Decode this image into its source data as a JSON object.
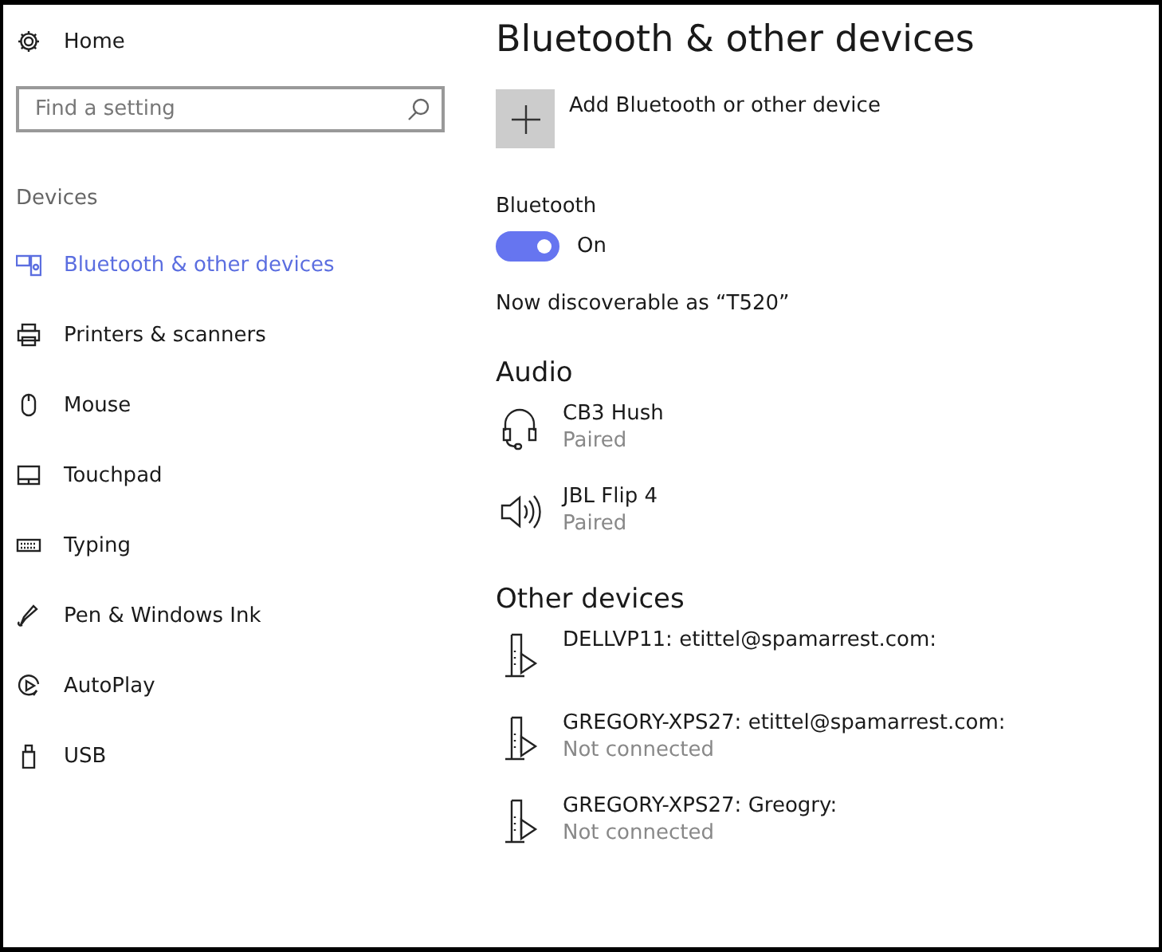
{
  "sidebar": {
    "home": {
      "label": "Home"
    },
    "search": {
      "placeholder": "Find a setting"
    },
    "section": "Devices",
    "items": [
      {
        "label": "Bluetooth & other devices",
        "kind": "bluetooth",
        "selected": true
      },
      {
        "label": "Printers & scanners",
        "kind": "printer",
        "selected": false
      },
      {
        "label": "Mouse",
        "kind": "mouse",
        "selected": false
      },
      {
        "label": "Touchpad",
        "kind": "touchpad",
        "selected": false
      },
      {
        "label": "Typing",
        "kind": "keyboard",
        "selected": false
      },
      {
        "label": "Pen & Windows Ink",
        "kind": "pen",
        "selected": false
      },
      {
        "label": "AutoPlay",
        "kind": "autoplay",
        "selected": false
      },
      {
        "label": "USB",
        "kind": "usb",
        "selected": false
      }
    ]
  },
  "main": {
    "title": "Bluetooth & other devices",
    "add_button": {
      "label": "Add Bluetooth or other device"
    },
    "bluetooth": {
      "label": "Bluetooth",
      "on": true,
      "state_text": "On"
    },
    "discoverable": "Now discoverable as “T520”",
    "sections": [
      {
        "title": "Audio",
        "devices": [
          {
            "kind": "headset",
            "name": "CB3 Hush",
            "status": "Paired"
          },
          {
            "kind": "speaker",
            "name": "JBL Flip 4",
            "status": "Paired"
          }
        ]
      },
      {
        "title": "Other devices",
        "devices": [
          {
            "kind": "media",
            "name": "DELLVP11: etittel@spamarrest.com:"
          },
          {
            "kind": "media",
            "name": "GREGORY-XPS27: etittel@spamarrest.com:",
            "status": "Not connected"
          },
          {
            "kind": "media",
            "name": "GREGORY-XPS27: Greogry:",
            "status": "Not connected"
          }
        ]
      }
    ]
  }
}
